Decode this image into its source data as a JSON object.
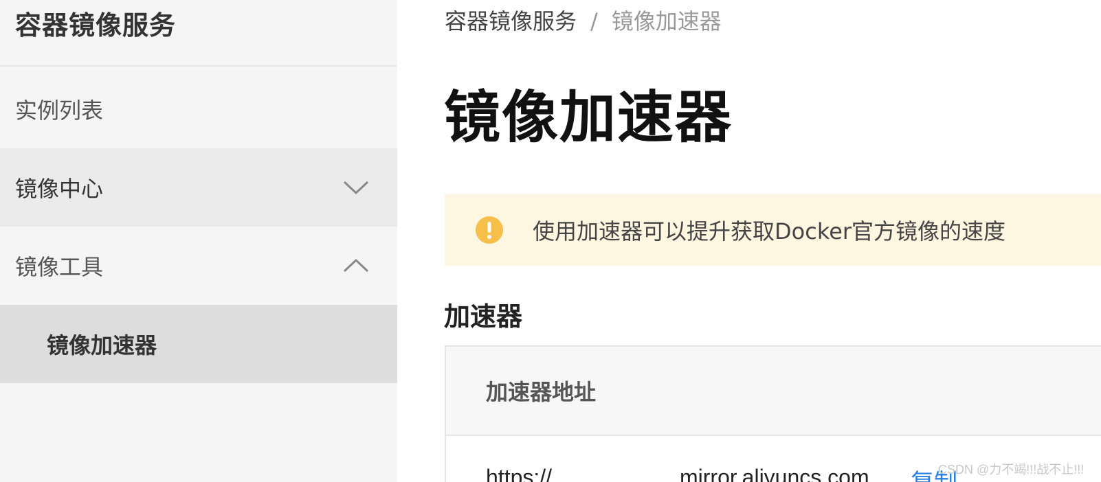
{
  "sidebar": {
    "title": "容器镜像服务",
    "items": [
      {
        "label": "实例列表"
      },
      {
        "label": "镜像中心",
        "expanded": false
      },
      {
        "label": "镜像工具",
        "expanded": true
      },
      {
        "label": "镜像加速器",
        "selected": true
      }
    ]
  },
  "header": {
    "breadcrumb": {
      "root": "容器镜像服务",
      "separator": "/",
      "current": "镜像加速器"
    },
    "title": "镜像加速器"
  },
  "alert": {
    "icon": "exclamation-circle-icon",
    "text": "使用加速器可以提升获取Docker官方镜像的速度",
    "color": "#f5bf4a"
  },
  "accelerator": {
    "section_title": "加速器",
    "table": {
      "column_header": "加速器地址",
      "url_prefix": "https://",
      "url_suffix": "mirror.aliyuncs.com",
      "copy_label": "复制"
    }
  },
  "watermark": "CSDN @力不竭!!!战不止!!!",
  "colors": {
    "link": "#2a7ee0",
    "alert_bg": "#fdf6e0",
    "sidebar_bg": "#f5f5f5",
    "selected_bg": "#dddddd"
  }
}
